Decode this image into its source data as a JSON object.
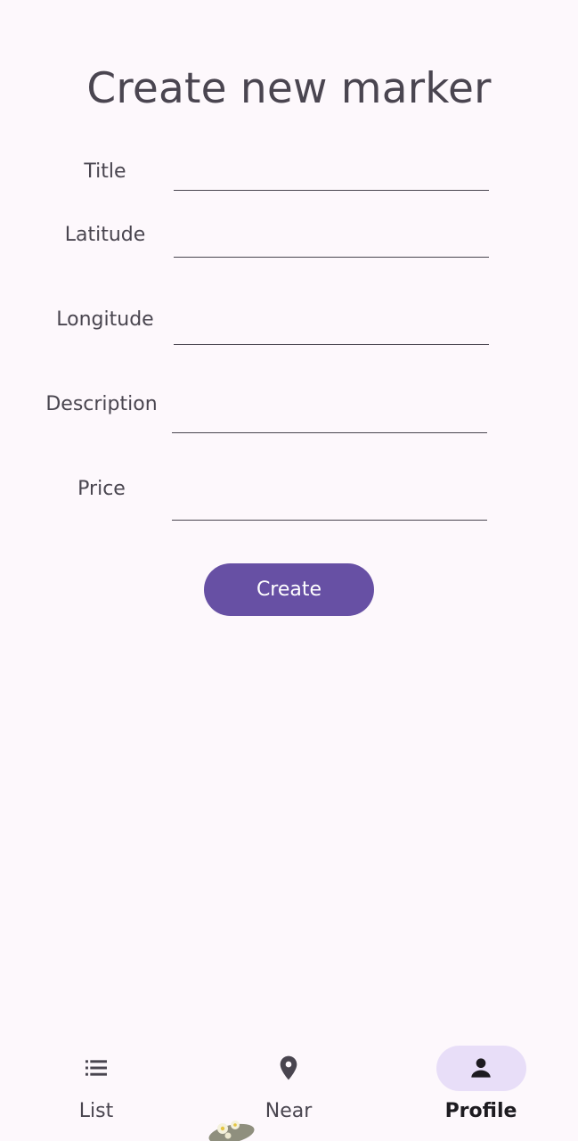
{
  "page": {
    "title": "Create new marker"
  },
  "form": {
    "fields": [
      {
        "label": "Title",
        "value": ""
      },
      {
        "label": "Latitude",
        "value": ""
      },
      {
        "label": "Longitude",
        "value": ""
      },
      {
        "label": "Description",
        "value": ""
      },
      {
        "label": "Price",
        "value": ""
      }
    ],
    "create_label": "Create"
  },
  "bottom_nav": {
    "items": [
      {
        "label": "List",
        "icon": "list-icon",
        "active": false
      },
      {
        "label": "Near",
        "icon": "location-pin-icon",
        "active": false
      },
      {
        "label": "Profile",
        "icon": "person-icon",
        "active": true
      }
    ]
  },
  "colors": {
    "background": "#fdf8fc",
    "primary": "#6750a4",
    "nav_indicator": "#e8def8",
    "text": "#49454f"
  }
}
